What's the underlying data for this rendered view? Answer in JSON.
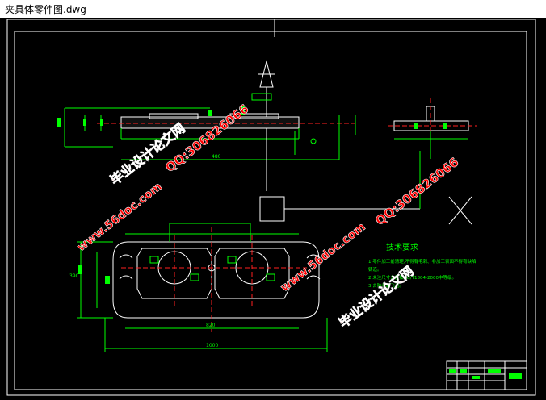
{
  "window": {
    "title": "夹具体零件图.dwg"
  },
  "drawing": {
    "tech_req": {
      "heading": "技术要求",
      "lines": [
        "1.零件加工前清理,不得有毛刺、非加工表面不得有缺陷",
        "  铸造。",
        "2.未注尺寸公差按GB/T1804-2000中等级。",
        "3.去除毛刺飞边。"
      ]
    },
    "dimension_labels": [
      "1000",
      "820",
      "480",
      "390"
    ],
    "watermarks": [
      {
        "text": "毕业设计论文网"
      },
      {
        "text": "www.56doc.com"
      },
      {
        "text": "QQ:306826066"
      }
    ]
  },
  "colors": {
    "background": "#000000",
    "frame": "#ffffff",
    "outline": "#ffffff",
    "dimension": "#00ff00",
    "centerline": "#ff2020",
    "watermark": "#ff0000"
  }
}
